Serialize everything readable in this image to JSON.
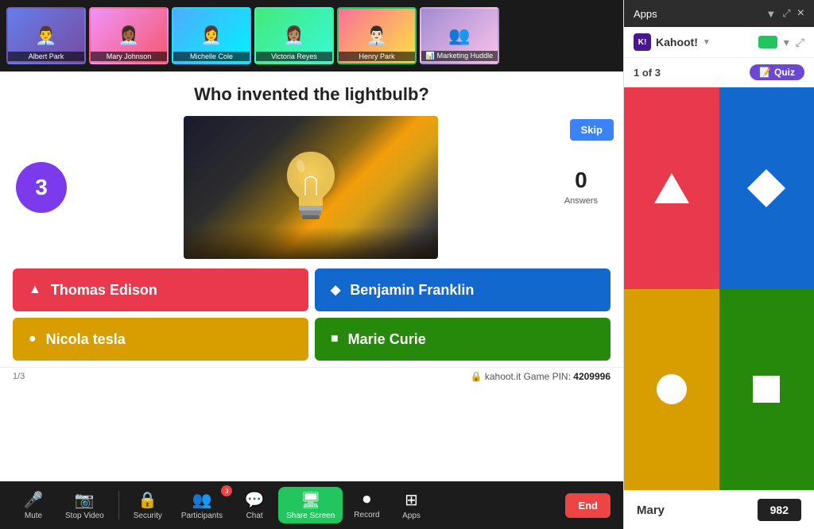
{
  "header": {
    "apps_label": "Apps",
    "close_label": "×"
  },
  "video_strip": {
    "participants": [
      {
        "id": "albert",
        "name": "Albert Park",
        "emoji": "👨‍💼",
        "class": "av1",
        "active": false
      },
      {
        "id": "mary",
        "name": "Mary Johnson",
        "emoji": "👩🏾‍💼",
        "class": "av2",
        "active": false
      },
      {
        "id": "michelle",
        "name": "Michelle Cole",
        "emoji": "👩‍💼",
        "class": "av3",
        "active": false
      },
      {
        "id": "victoria",
        "name": "Victoria Reyes",
        "emoji": "👩🏽‍💼",
        "class": "av4",
        "active": false
      },
      {
        "id": "henry",
        "name": "Henry Park",
        "emoji": "👨🏻‍💼",
        "class": "av5",
        "active": true
      },
      {
        "id": "marketing",
        "name": "📊 Marketing Huddle",
        "emoji": "👥",
        "class": "av6",
        "active": false
      }
    ]
  },
  "kahoot": {
    "question": "Who invented the lightbulb?",
    "timer": "3",
    "skip_label": "Skip",
    "answers_count": "0",
    "answers_label": "Answers",
    "answers": [
      {
        "id": "a1",
        "text": "Thomas Edison",
        "color": "red",
        "shape": "triangle"
      },
      {
        "id": "a2",
        "text": "Benjamin Franklin",
        "color": "blue",
        "shape": "diamond"
      },
      {
        "id": "a3",
        "text": "Nicola tesla",
        "color": "yellow",
        "shape": "circle"
      },
      {
        "id": "a4",
        "text": "Marie Curie",
        "color": "green",
        "shape": "square"
      }
    ],
    "footer": {
      "page": "1/3",
      "lock_icon": "🔒",
      "site": "kahoot.it",
      "game_pin_label": "Game PIN:",
      "game_pin": "4209996"
    }
  },
  "toolbar": {
    "items": [
      {
        "id": "mute",
        "icon": "🎤",
        "label": "Mute",
        "has_badge": false,
        "badge_count": ""
      },
      {
        "id": "video",
        "icon": "📷",
        "label": "Stop Video",
        "has_badge": false,
        "badge_count": ""
      },
      {
        "id": "security",
        "icon": "🔒",
        "label": "Security",
        "has_badge": false,
        "badge_count": ""
      },
      {
        "id": "participants",
        "icon": "👥",
        "label": "Participants",
        "has_badge": true,
        "badge_count": "3"
      },
      {
        "id": "chat",
        "icon": "💬",
        "label": "Chat",
        "has_badge": false,
        "badge_count": ""
      },
      {
        "id": "share",
        "icon": "🖥",
        "label": "Share Screen",
        "has_badge": false,
        "badge_count": "",
        "highlight": true
      },
      {
        "id": "record",
        "icon": "⏺",
        "label": "Record",
        "has_badge": false,
        "badge_count": ""
      },
      {
        "id": "apps",
        "icon": "⊞",
        "label": "Apps",
        "has_badge": false,
        "badge_count": ""
      }
    ],
    "end_label": "End"
  },
  "sidebar": {
    "title": "Apps",
    "kahoot_label": "Kahoot!",
    "quiz_counter": "1 of 3",
    "quiz_label": "Quiz",
    "shapes": [
      {
        "id": "s1",
        "color": "red",
        "shape": "triangle"
      },
      {
        "id": "s2",
        "color": "blue",
        "shape": "diamond"
      },
      {
        "id": "s3",
        "color": "yellow",
        "shape": "circle"
      },
      {
        "id": "s4",
        "color": "green",
        "shape": "square"
      }
    ],
    "leaderboard": {
      "name": "Mary",
      "score": "982"
    }
  }
}
